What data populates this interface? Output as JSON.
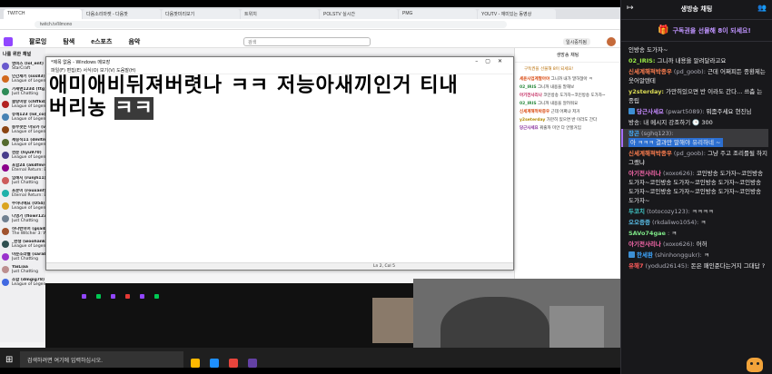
{
  "browser": {
    "tabs": [
      "TWITCH",
      "다음소리마켓 - 다음팟",
      "다음팟미리보기",
      "트위치",
      "POLSTV 실시간",
      "PMG",
      "YOUTV - 재미있는 동영상",
      "NOW TV"
    ],
    "url": "twitch.tv/lilmono"
  },
  "twitch": {
    "nav": [
      "팔로잉",
      "탐색",
      "e스포츠",
      "음악"
    ],
    "search_placeholder": "검색",
    "prime_label": "일시중지됨",
    "sidebar_header": "나를 위한 채널",
    "channels": [
      {
        "name": "엔비즈 (lol_ent)",
        "game": "StarCraft",
        "color": "#6a5acd"
      },
      {
        "name": "인간제키 (sss83)",
        "game": "League of Legends",
        "color": "#d2691e"
      },
      {
        "name": "가재맨1234 (ttg)",
        "game": "Just Chatting",
        "color": "#2e8b57"
      },
      {
        "name": "골랑이랑 (chffkd)",
        "game": "League of Legends",
        "color": "#b22222"
      },
      {
        "name": "유헤123 (lol_co)",
        "game": "League of Legends",
        "color": "#4682b4"
      },
      {
        "name": "동부팟는 마오카 (v)",
        "game": "League of Legends",
        "color": "#8b4513"
      },
      {
        "name": "제승식11 (dmltmd)",
        "game": "League of Legends",
        "color": "#556b2f"
      },
      {
        "name": "현준 (hyu970)",
        "game": "League of Legends",
        "color": "#483d8b"
      },
      {
        "name": "포함24 (akdfmrot)",
        "game": "Eternal Return: Bl",
        "color": "#8b008b"
      },
      {
        "name": "임해지 (runjh11)",
        "game": "Just Chatting",
        "color": "#cd5c5c"
      },
      {
        "name": "포문이 (rouxanf)",
        "game": "Eternal Return: Bl",
        "color": "#20b2aa"
      },
      {
        "name": "수하나에요 (O54)",
        "game": "League of Legends",
        "color": "#daa520"
      },
      {
        "name": "다영기 (flowr123)",
        "game": "Just Chatting",
        "color": "#708090"
      },
      {
        "name": "하나반이어 (gsaib)",
        "game": "The Witcher 3: Wi",
        "color": "#a0522d"
      },
      {
        "name": "_완쟁 (woohanky)",
        "game": "League of Legends",
        "color": "#2f4f4f"
      },
      {
        "name": "이준소라벨 (sarab)",
        "game": "Just Chatting",
        "color": "#9932cc"
      },
      {
        "name": "YaiLiaa",
        "game": "Just Chatting",
        "color": "#bc8f8f"
      },
      {
        "name": "조합 (dmgig78)",
        "game": "League of Legends",
        "color": "#4169e1"
      }
    ]
  },
  "notepad": {
    "title": "*제목 없음 - Windows 메모장",
    "menu": "파일(F)   편집(E)   서식(O)   보기(V)   도움말(H)",
    "line1": "애미애비뒤져버렷나 ㅋㅋ 저능아새끼인거 티내",
    "line2_plain": "버리농 ",
    "line2_selected": "ㅋㅋ",
    "status_pos": "Ln 2, Col 5"
  },
  "stream_chat": {
    "title": "생방송 채팅",
    "gift": "구독권을 선물해 8이 되세요!",
    "lines": [
      {
        "user": "세윤사업계팔아야",
        "text": "그니까 내가 말하잖아 ㅋ"
      },
      {
        "user": "02_IRIS",
        "text": "그니까 내용을 말해보"
      },
      {
        "user": "아기전사리나",
        "text": "코인방송 도가자~코인방송 도가자~"
      },
      {
        "user": "02_IRIS",
        "text": "그니까 내용을 알려줘요"
      },
      {
        "user": "신세계해적박종우",
        "text": "근데 어쩌냐 저거"
      },
      {
        "user": "y2seterday",
        "text": "가만히 있으면 반 이라도 간다"
      },
      {
        "user": "당근사세요",
        "text": "꿔줄까 미안 다 안할거임"
      }
    ]
  },
  "taskbar": {
    "search": "검색하려면 여기에 입력하십시오."
  },
  "chat": {
    "title": "생방송 채팅",
    "gift": "구독권을 선물해 8이 되세요!",
    "messages": [
      {
        "type": "plain",
        "text": "인방송 도가자~"
      },
      {
        "type": "user",
        "user": "02_IRIS:",
        "color": "#9aea47",
        "text": " 그니까 내용을 알려달라고요"
      },
      {
        "type": "user",
        "user": "신세계해적박종우",
        "id": " (pd_goob):",
        "color": "#ff7f50",
        "text": " 근데 어쩌피든 종환제는 웃어알텐데"
      },
      {
        "type": "user",
        "user": "y2sterday:",
        "color": "#dddd55",
        "text": " 가만히있으면 반 이라도 간다... 쓰츰 는 종립"
      },
      {
        "type": "badge",
        "user": "당근사세요",
        "id": " (pwart5089):",
        "color": "#c58aff",
        "text": " 뭐좀주세요 현진님"
      },
      {
        "type": "plain",
        "text": "방송: 내 메시지 강조하기  🕒 300"
      },
      {
        "type": "highlight",
        "user": "장곤",
        "id": " (sghq123):",
        "color": "#43aeff",
        "text": "아 ㅋㅋㅋ 결과만 말해야 유리하네 ~"
      },
      {
        "type": "user",
        "user": "신세계해적박종우",
        "id": " (pd_goob):",
        "color": "#ff7f50",
        "text": " 그냥 주고 조리를될 하지그랬냐"
      },
      {
        "type": "user",
        "user": "아기전사리나",
        "id": " (xoxo626):",
        "color": "#ff6bb0",
        "text": " 코인방송 도가자~코인방송 도가자~코인방송 도가자~코인방송 도가자~코인방송 도가자~코인방송 도가자~코인방송 도가자~코인방송 도가자~"
      },
      {
        "type": "user",
        "user": "두코치",
        "id": " (totocozy123):",
        "color": "#40c9c9",
        "text": " ㅋㅋㅋㅋ"
      },
      {
        "type": "user",
        "user": "오오증증",
        "id": " (rkdaliwo1054):",
        "color": "#5bc0eb",
        "text": " ㅋ"
      },
      {
        "type": "user",
        "user": "SAVo74gae",
        "id": " :",
        "color": "#7ee787",
        "text": " ㅋ"
      },
      {
        "type": "user",
        "user": "아기전사리나",
        "id": " (xoxo626):",
        "color": "#ff6bb0",
        "text": " 어허"
      },
      {
        "type": "badge",
        "user": "한세환",
        "id": " (shinhonggukr):",
        "color": "#3ea6ff",
        "text": " ㅋ"
      },
      {
        "type": "user",
        "user": "유해7",
        "id": " (yodud26145):",
        "color": "#ff5b5b",
        "text": " 돈은 패인준다는거지 그대답 ?"
      }
    ]
  }
}
